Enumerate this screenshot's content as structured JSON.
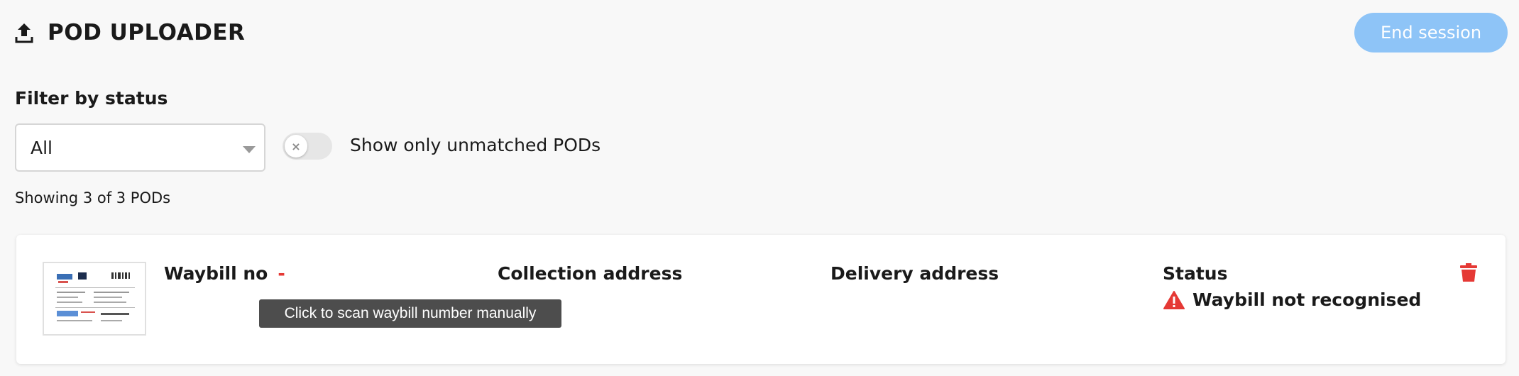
{
  "header": {
    "title": "POD UPLOADER",
    "icon": "upload-icon",
    "end_session_label": "End session"
  },
  "filter": {
    "label": "Filter by status",
    "selected_value": "All",
    "toggle_label": "Show only unmatched PODs",
    "toggle_on": false
  },
  "summary": {
    "showing_text": "Showing 3 of 3 PODs"
  },
  "pod_card": {
    "waybill_label": "Waybill no",
    "waybill_value": "-",
    "collection_label": "Collection address",
    "delivery_label": "Delivery address",
    "status_label": "Status",
    "status_text": "Waybill not recognised",
    "tooltip": "Click to scan waybill number manually"
  },
  "colors": {
    "accent": "#8ec4f7",
    "danger": "#e53935",
    "background": "#f8f8f8"
  }
}
